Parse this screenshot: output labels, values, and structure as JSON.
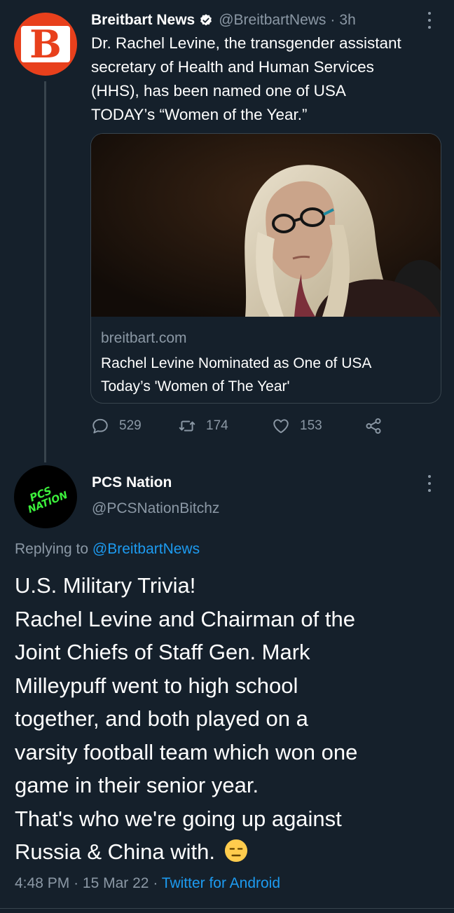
{
  "tweet1": {
    "author_name": "Breitbart News",
    "handle": "@BreitbartNews",
    "separator": "·",
    "time": "3h",
    "avatar_letter": "B",
    "text_lines": [
      "Dr. Rachel Levine, the transgender assistant",
      "secretary of Health and Human Services",
      "(HHS), has been named one of USA",
      "TODAY’s “Women of the Year.”"
    ],
    "card": {
      "domain": "breitbart.com",
      "title_lines": [
        "Rachel Levine Nominated as One of USA",
        "Today’s 'Women of The Year'"
      ]
    },
    "actions": {
      "replies": "529",
      "retweets": "174",
      "likes": "153"
    }
  },
  "tweet2": {
    "author_name": "PCS Nation",
    "handle": "@PCSNationBitchz",
    "avatar_text_1": "PCS",
    "avatar_text_2": "NATION",
    "replying_prefix": "Replying to ",
    "replying_mention": "@BreitbartNews",
    "text_lines": [
      "U.S. Military Trivia!",
      "Rachel Levine and Chairman of the",
      "Joint Chiefs of Staff Gen. Mark",
      "Milleypuff went to high school",
      "together, and both played on a",
      "varsity football team which won one",
      "game in their senior year.",
      "That's who we're going up against",
      "Russia & China with."
    ],
    "emoji": "expressionless-face-emoji",
    "time": "4:48 PM",
    "separator": "·",
    "date": "15 Mar 22",
    "source": "Twitter for Android"
  },
  "colors": {
    "background": "#15202b",
    "secondary_text": "#8b98a5",
    "link": "#1d9bf0",
    "breitbart_orange": "#e8401c",
    "pcs_green": "#3cf03c",
    "border": "#38444d"
  }
}
